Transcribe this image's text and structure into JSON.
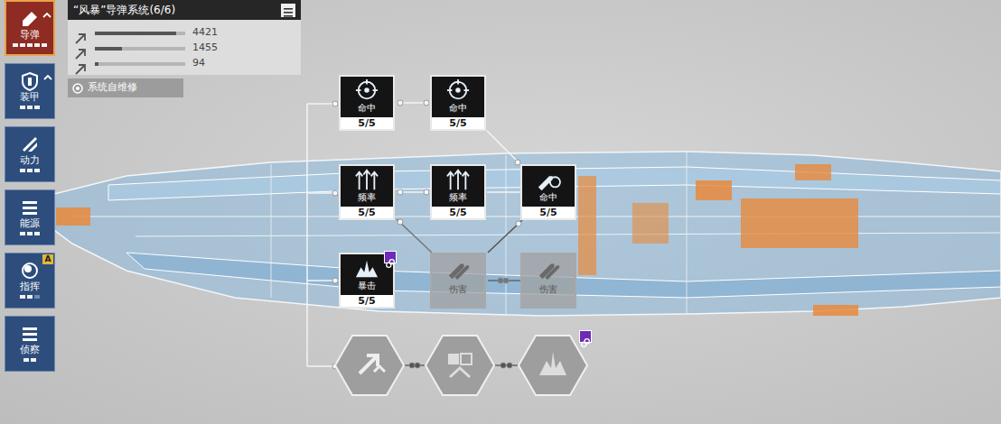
{
  "sidebar": {
    "items": [
      {
        "label": "导弹",
        "selected": true,
        "upgrade": true,
        "badge": "",
        "pips": 5,
        "pips_filled": 5
      },
      {
        "label": "装甲",
        "selected": false,
        "upgrade": true,
        "badge": "",
        "pips": 3,
        "pips_filled": 3
      },
      {
        "label": "动力",
        "selected": false,
        "upgrade": false,
        "badge": "",
        "pips": 3,
        "pips_filled": 3
      },
      {
        "label": "能源",
        "selected": false,
        "upgrade": false,
        "badge": "",
        "pips": 3,
        "pips_filled": 3
      },
      {
        "label": "指挥",
        "selected": false,
        "upgrade": false,
        "badge": "A",
        "pips": 3,
        "pips_filled": 2
      },
      {
        "label": "侦察",
        "selected": false,
        "upgrade": false,
        "badge": "",
        "pips": 2,
        "pips_filled": 2
      }
    ]
  },
  "panel": {
    "title": "“风暴”导弹系统(6/6)",
    "stats": [
      {
        "value": "4421",
        "level": 0.9
      },
      {
        "value": "1455",
        "level": 0.3
      },
      {
        "value": "94",
        "level": 0.04
      }
    ],
    "skill": "系统自维修"
  },
  "tree": {
    "nodes": [
      {
        "kind": "square",
        "label": "命中",
        "progress": "5/5",
        "unlocked": true,
        "linked": false
      },
      {
        "kind": "square",
        "label": "命中",
        "progress": "5/5",
        "unlocked": true,
        "linked": false
      },
      {
        "kind": "square",
        "label": "频率",
        "progress": "5/5",
        "unlocked": true,
        "linked": false
      },
      {
        "kind": "square",
        "label": "频率",
        "progress": "5/5",
        "unlocked": true,
        "linked": false
      },
      {
        "kind": "square",
        "label": "命中",
        "progress": "5/5",
        "unlocked": true,
        "linked": false
      },
      {
        "kind": "square",
        "label": "暴击",
        "progress": "5/5",
        "unlocked": true,
        "linked": true
      },
      {
        "kind": "square",
        "label": "伤害",
        "unlocked": false,
        "linked": false
      },
      {
        "kind": "square",
        "label": "伤害",
        "unlocked": false,
        "linked": false
      },
      {
        "kind": "hex",
        "unlocked": false,
        "linked": false
      },
      {
        "kind": "hex",
        "unlocked": false,
        "linked": false
      },
      {
        "kind": "hex",
        "unlocked": false,
        "linked": true
      }
    ]
  }
}
